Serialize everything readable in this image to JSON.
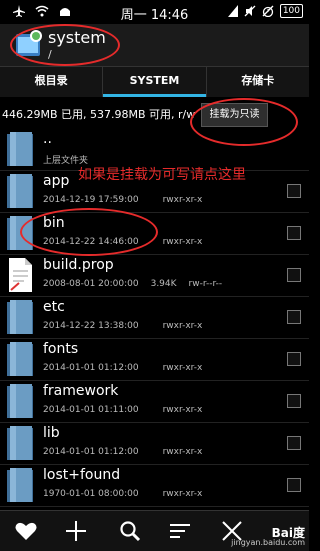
{
  "status_bar": {
    "time": "周一 14:46",
    "battery": "100"
  },
  "app": {
    "title": "system",
    "subtitle": "/"
  },
  "tabs": [
    {
      "label": "根目录",
      "active": false
    },
    {
      "label": "SYSTEM",
      "active": true
    },
    {
      "label": "存储卡",
      "active": false
    }
  ],
  "info": {
    "space_text": "446.29MB 已用, 537.98MB 可用, r/w"
  },
  "mount_button": {
    "label": "挂载为只读"
  },
  "annotation": {
    "text": "如果是挂载为可写请点这里"
  },
  "files": [
    {
      "name": "..",
      "date": "上层文件夹",
      "size": "",
      "perms": "",
      "type": "folder"
    },
    {
      "name": "app",
      "date": "2014-12-19 17:59:00",
      "size": "",
      "perms": "rwxr-xr-x",
      "type": "folder"
    },
    {
      "name": "bin",
      "date": "2014-12-22 14:46:00",
      "size": "",
      "perms": "rwxr-xr-x",
      "type": "folder"
    },
    {
      "name": "build.prop",
      "date": "2008-08-01 20:00:00",
      "size": "3.94K",
      "perms": "rw-r--r--",
      "type": "file"
    },
    {
      "name": "etc",
      "date": "2014-12-22 13:38:00",
      "size": "",
      "perms": "rwxr-xr-x",
      "type": "folder"
    },
    {
      "name": "fonts",
      "date": "2014-01-01 01:12:00",
      "size": "",
      "perms": "rwxr-xr-x",
      "type": "folder"
    },
    {
      "name": "framework",
      "date": "2014-01-01 01:11:00",
      "size": "",
      "perms": "rwxr-xr-x",
      "type": "folder"
    },
    {
      "name": "lib",
      "date": "2014-01-01 01:12:00",
      "size": "",
      "perms": "rwxr-xr-x",
      "type": "folder"
    },
    {
      "name": "lost+found",
      "date": "1970-01-01 08:00:00",
      "size": "",
      "perms": "rwxr-xr-x",
      "type": "folder"
    }
  ],
  "bottom_icons": [
    "heart-icon",
    "plus-icon",
    "search-icon",
    "sort-icon",
    "close-icon"
  ],
  "watermark": {
    "brand": "Bai度",
    "url": "jingyan.baidu.com"
  },
  "colors": {
    "accent": "#33b5e5",
    "annotation_red": "#e52b2b",
    "folder_blue": "#6b9cc3"
  }
}
